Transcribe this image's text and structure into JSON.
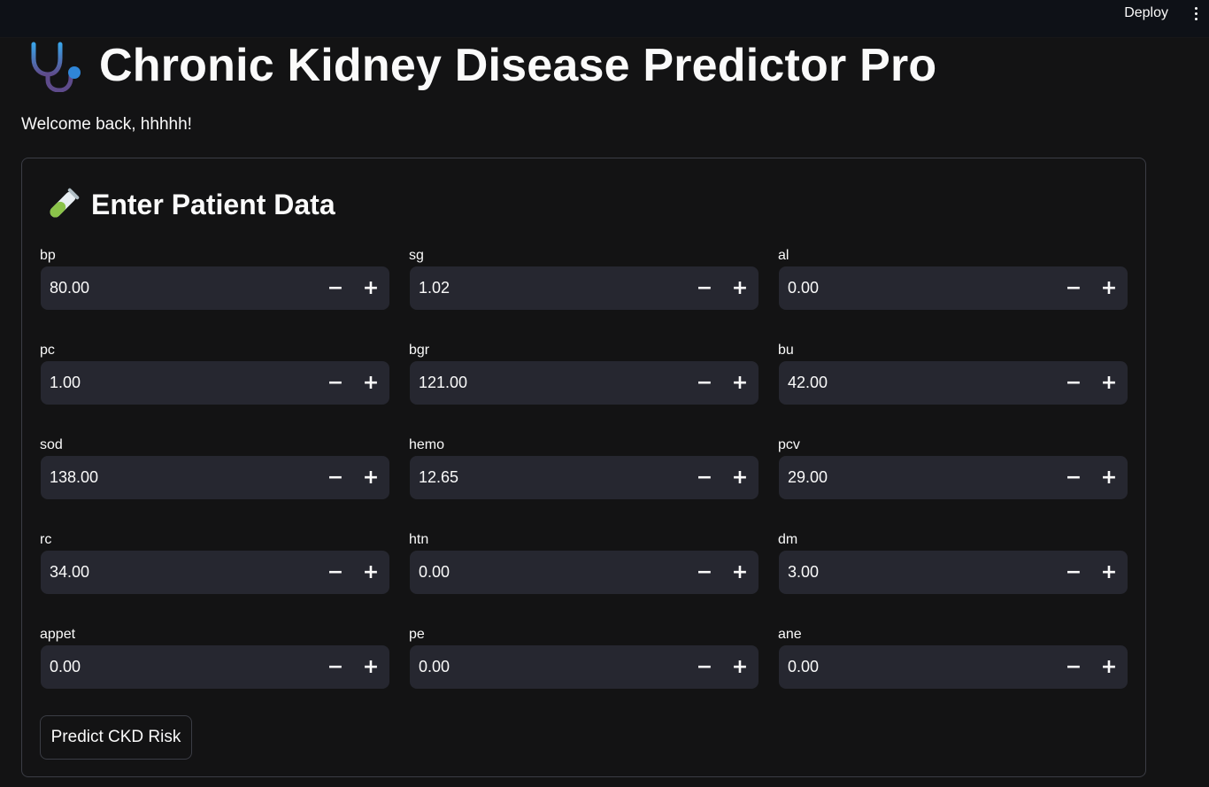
{
  "topbar": {
    "deploy_label": "Deploy",
    "menu_icon": "vertical-ellipsis-icon"
  },
  "header": {
    "title": "Chronic Kidney Disease Predictor Pro",
    "icon": "stethoscope-icon",
    "welcome": "Welcome back, hhhhh!"
  },
  "form": {
    "title": "Enter Patient Data",
    "icon": "test-tube-icon",
    "fields": [
      {
        "label": "bp",
        "value": "80.00"
      },
      {
        "label": "sg",
        "value": "1.02"
      },
      {
        "label": "al",
        "value": "0.00"
      },
      {
        "label": "pc",
        "value": "1.00"
      },
      {
        "label": "bgr",
        "value": "121.00"
      },
      {
        "label": "bu",
        "value": "42.00"
      },
      {
        "label": "sod",
        "value": "138.00"
      },
      {
        "label": "hemo",
        "value": "12.65"
      },
      {
        "label": "pcv",
        "value": "29.00"
      },
      {
        "label": "rc",
        "value": "34.00"
      },
      {
        "label": "htn",
        "value": "0.00"
      },
      {
        "label": "dm",
        "value": "3.00"
      },
      {
        "label": "appet",
        "value": "0.00"
      },
      {
        "label": "pe",
        "value": "0.00"
      },
      {
        "label": "ane",
        "value": "0.00"
      }
    ],
    "stepper_minus": "−",
    "stepper_plus": "+",
    "submit_label": "Predict CKD Risk"
  },
  "colors": {
    "background": "#131314",
    "input_bg": "#262730",
    "border": "#3b3d45",
    "text": "#fafafa"
  }
}
